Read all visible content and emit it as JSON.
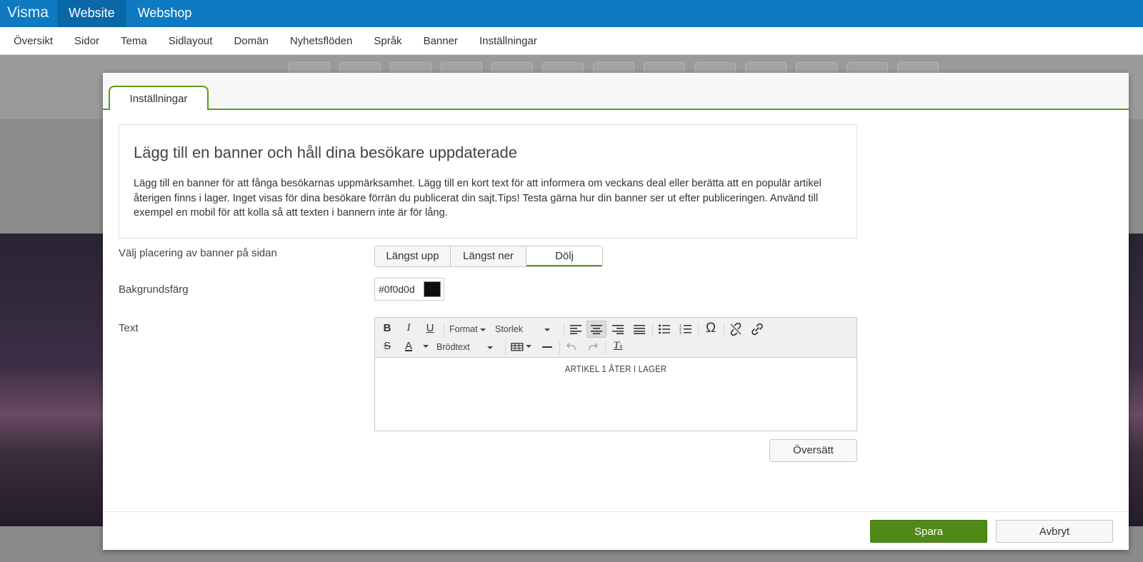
{
  "topbar": {
    "logo": "Visma",
    "tabs": [
      {
        "label": "Website",
        "active": true
      },
      {
        "label": "Webshop",
        "active": false
      }
    ]
  },
  "subnav": {
    "items": [
      "Översikt",
      "Sidor",
      "Tema",
      "Sidlayout",
      "Domän",
      "Nyhetsflöden",
      "Språk",
      "Banner",
      "Inställningar"
    ]
  },
  "modal": {
    "tab_label": "Inställningar",
    "info": {
      "title": "Lägg till en banner och håll dina besökare uppdaterade",
      "text": "Lägg till en banner för att fånga besökarnas uppmärksamhet. Lägg till en kort text för att informera om veckans deal eller berätta att en populär artikel återigen finns i lager. Inget visas för dina besökare förrän du publicerat din sajt.Tips! Testa gärna hur din banner ser ut efter publiceringen. Använd till exempel en mobil för att kolla så att texten i bannern inte är för lång."
    },
    "placement": {
      "label": "Välj placering av banner på sidan",
      "options": [
        "Längst upp",
        "Längst ner",
        "Dölj"
      ],
      "selected": "Dölj"
    },
    "background": {
      "label": "Bakgrundsfärg",
      "value": "#0f0d0d",
      "swatch_color": "#0f0d0d"
    },
    "text_editor": {
      "label": "Text",
      "toolbar": {
        "format_label": "Format",
        "size_label": "Storlek",
        "paragraph_label": "Brödtext",
        "active_alignment": "center"
      },
      "content": "ARTIKEL 1 ÅTER I LAGER"
    },
    "translate_label": "Översätt",
    "footer": {
      "save_label": "Spara",
      "cancel_label": "Avbryt"
    }
  },
  "colors": {
    "topbar": "#0f7ac1",
    "accent_green": "#5a9a1d",
    "save_button": "#4f8a16"
  }
}
